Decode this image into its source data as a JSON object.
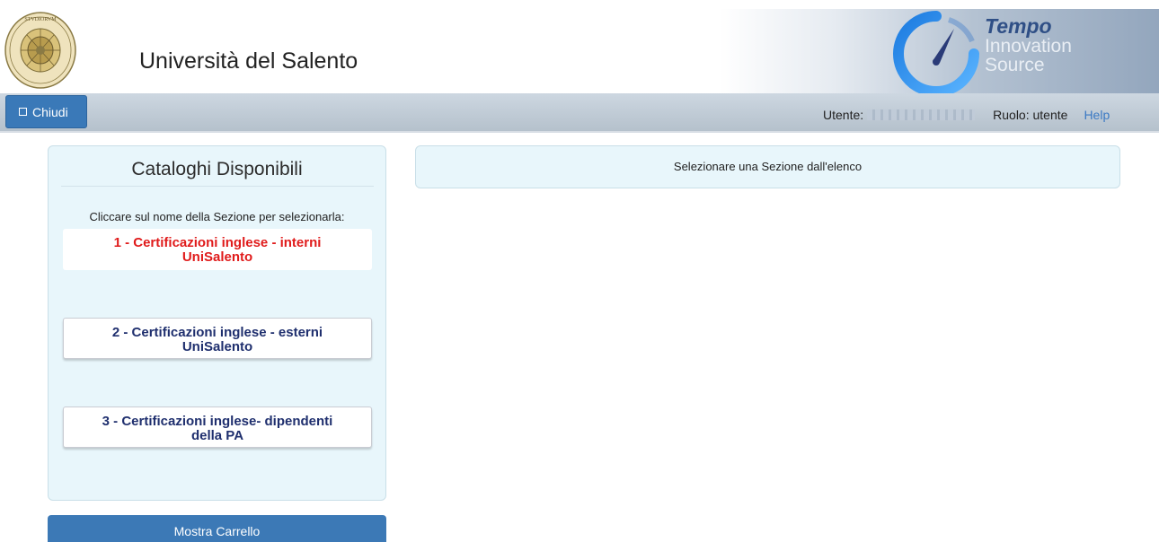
{
  "header": {
    "university_name": "Università del Salento",
    "logo_brand": "Tempo",
    "logo_line2": "Innovation",
    "logo_line3": "Source",
    "seal_icon": "university-seal-icon",
    "logo_icon": "tempo-gauge-icon"
  },
  "toolbar": {
    "close_label": "Chiudi",
    "user_label": "Utente:",
    "user_value_tail": "\\",
    "role_label": "Ruolo: utente",
    "help_label": "Help"
  },
  "catalog": {
    "title": "Cataloghi Disponibili",
    "hint": "Cliccare sul nome della Sezione per selezionarla:",
    "sections": [
      {
        "label": "1 - Certificazioni inglese - interni UniSalento",
        "selected": true
      },
      {
        "label": "2 - Certificazioni inglese - esterni UniSalento",
        "selected": false
      },
      {
        "label": "3 - Certificazioni inglese- dipendenti della PA",
        "selected": false
      }
    ]
  },
  "cart": {
    "label": "Mostra Carrello"
  },
  "main": {
    "message": "Selezionare una Sezione dall'elenco"
  },
  "colors": {
    "accent_blue": "#3a79b8",
    "active_section": "#e01b1b",
    "section_text": "#1f2f6e",
    "panel_bg": "#e8f6fb",
    "help_link": "#3a79c4"
  }
}
